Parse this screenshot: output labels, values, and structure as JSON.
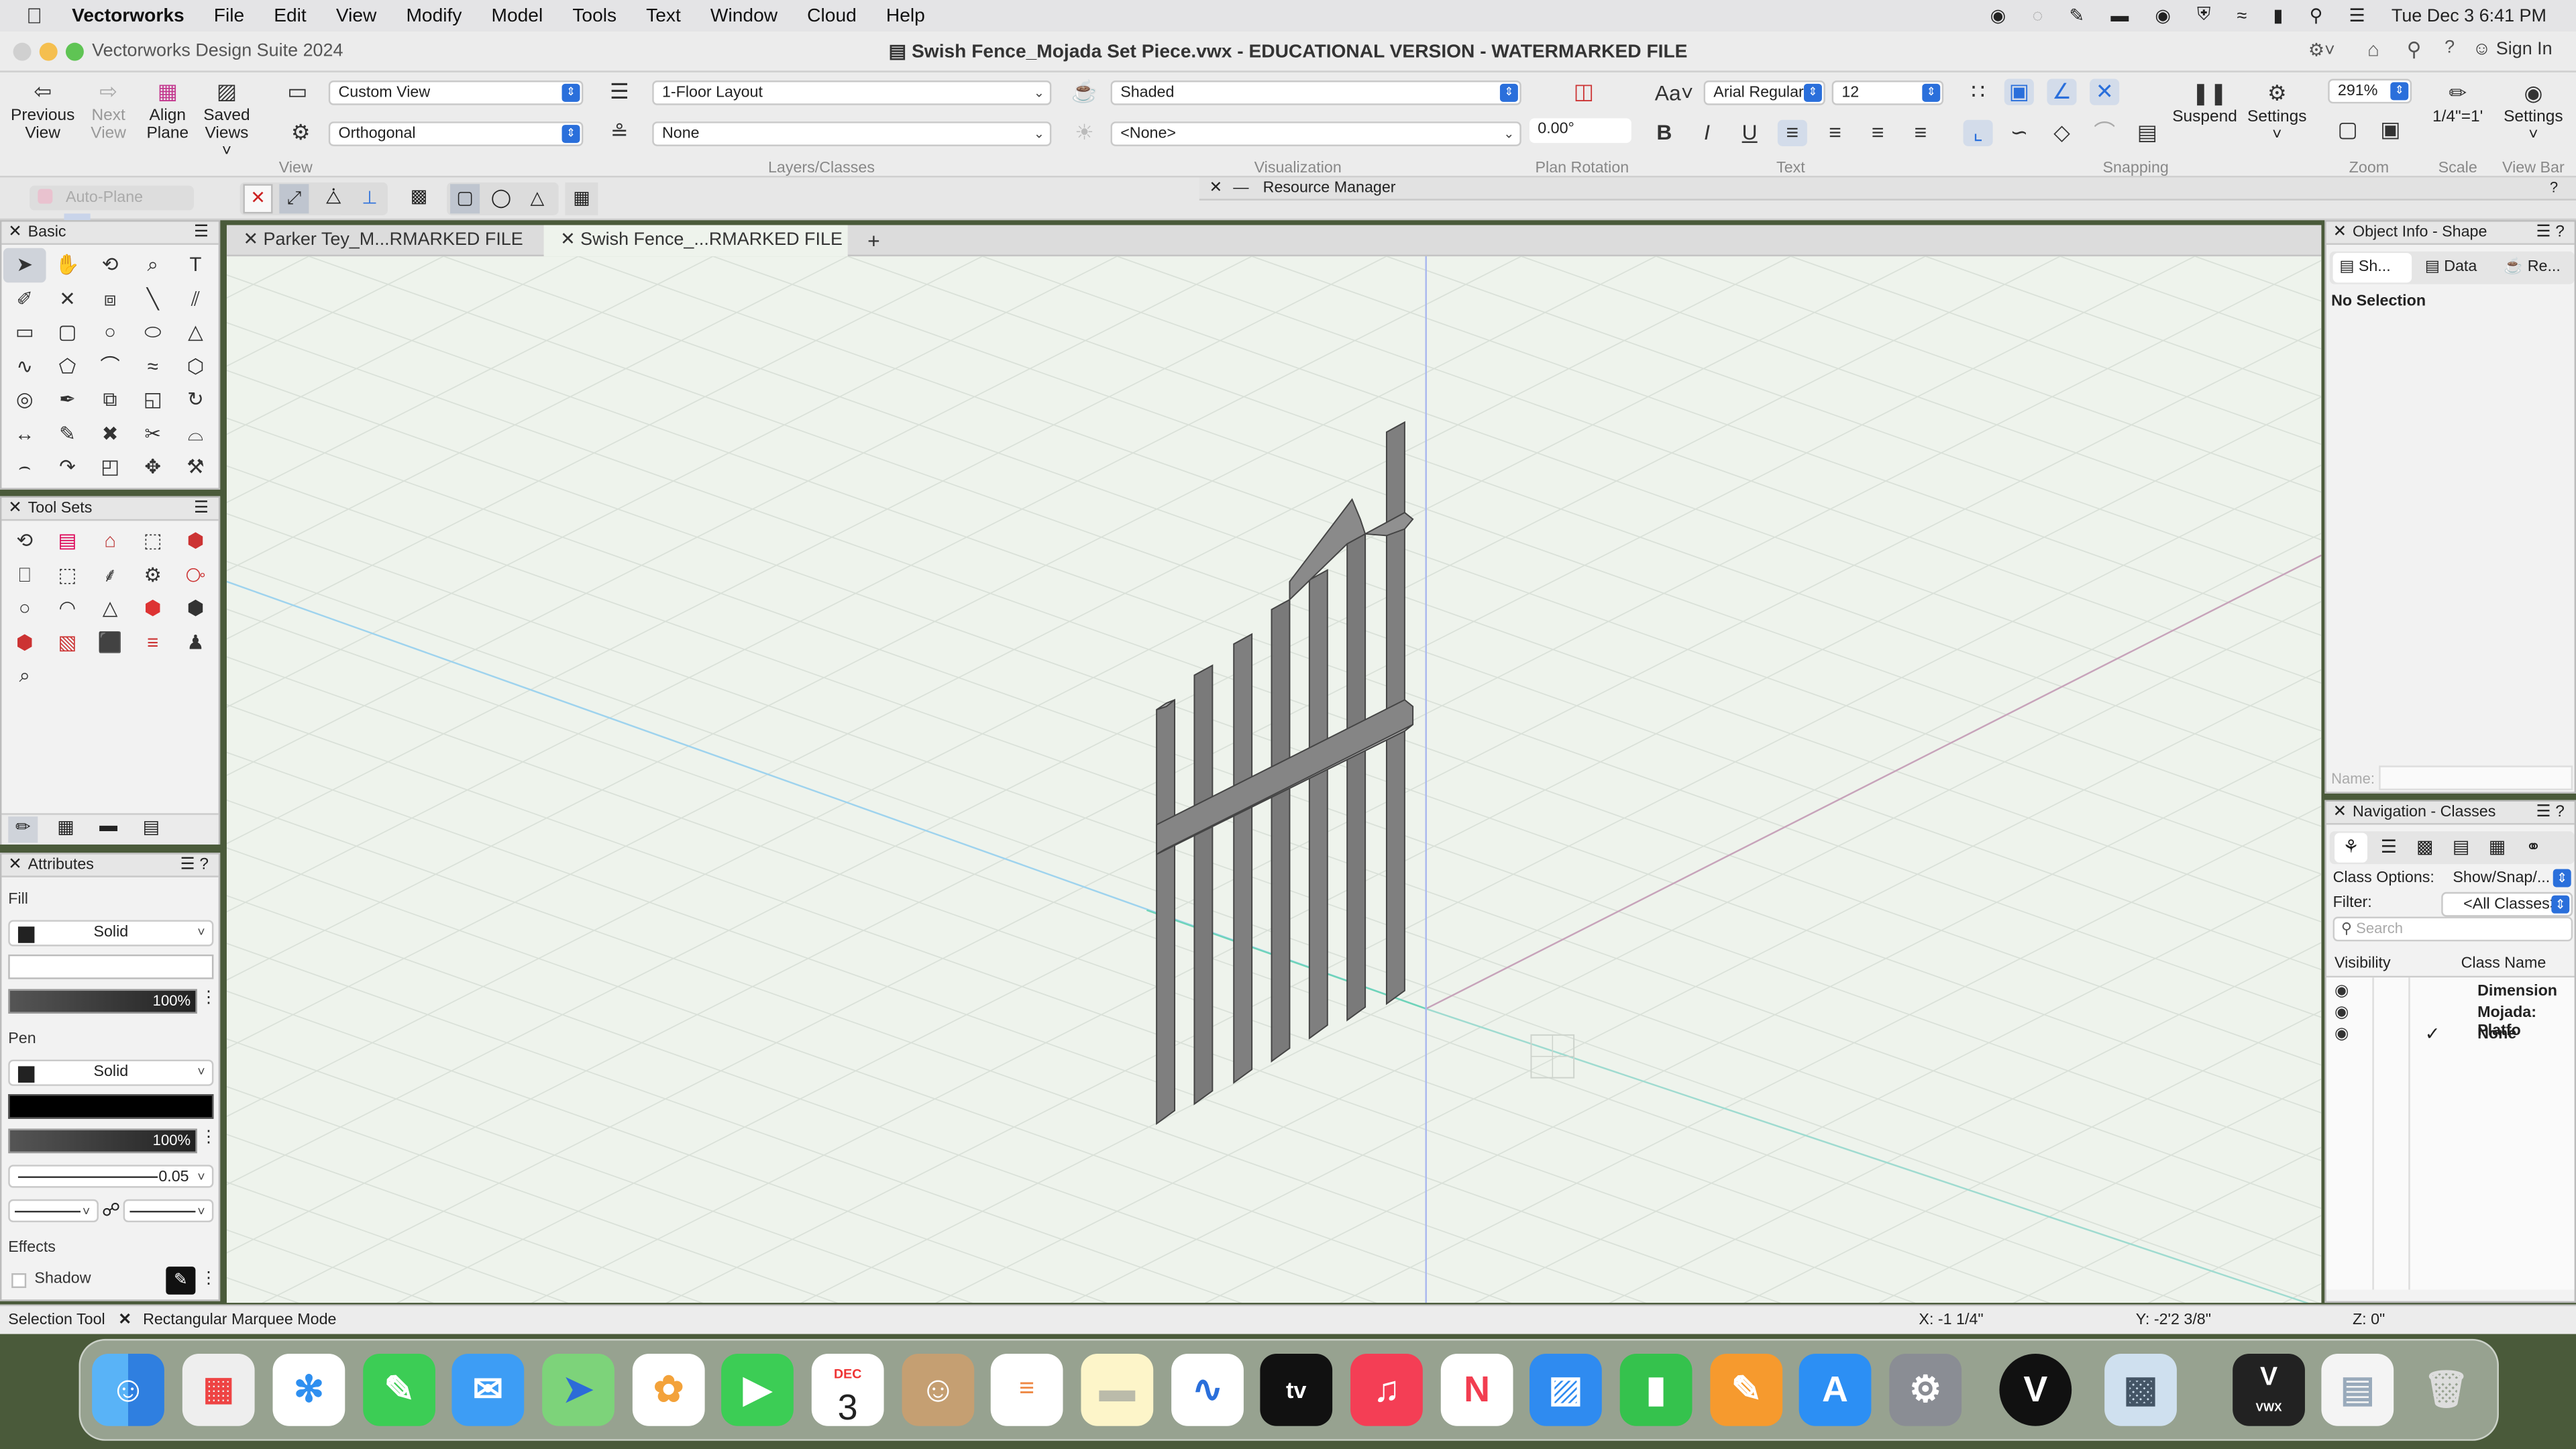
{
  "menubar": {
    "apple_icon": "apple-icon",
    "app": "Vectorworks",
    "items": [
      "File",
      "Edit",
      "View",
      "Modify",
      "Model",
      "Tools",
      "Text",
      "Window",
      "Cloud",
      "Help"
    ],
    "clock": "Tue Dec 3  6:41 PM"
  },
  "titlebar": {
    "app_title": "Vectorworks Design Suite 2024",
    "doc_title": "Swish Fence_Mojada Set Piece.vwx - EDUCATIONAL VERSION - WATERMARKED FILE",
    "sign_in": "Sign In"
  },
  "toolbar": {
    "previous_view": "Previous View",
    "next_view": "Next View",
    "align_plane": "Align Plane",
    "saved_views": "Saved Views",
    "view_dd": "Custom View",
    "projection_dd": "Orthogonal",
    "view_group": "View",
    "layer_dd": "1-Floor Layout",
    "class_dd": "None",
    "layers_group": "Layers/Classes",
    "render_dd": "Shaded",
    "light_dd": "<None>",
    "visualization_group": "Visualization",
    "plan_rotation": "0.00°",
    "plan_rotation_group": "Plan Rotation",
    "font_dd": "Arial Regular",
    "size_dd": "12",
    "text_group": "Text",
    "suspend": "Suspend",
    "settings": "Settings",
    "snapping_group": "Snapping",
    "zoom_dd": "291%",
    "zoom_group": "Zoom",
    "scale_value": "1/4\"=1'",
    "scale_group": "Scale",
    "viewbar_settings": "Settings",
    "viewbar_group": "View Bar"
  },
  "row2": {
    "auto_plane": "Auto-Plane",
    "resource_manager": "Resource Manager"
  },
  "tabs": [
    "Parker Tey_M...RMARKED FILE",
    "Swish Fence_...RMARKED FILE"
  ],
  "basic_palette": {
    "title": "Basic",
    "tools": [
      "selection-arrow-icon",
      "pan-hand-icon",
      "flyover-icon",
      "zoom-icon",
      "text-T-icon",
      "callout-icon",
      "x-icon",
      "push-pull-icon",
      "line-icon",
      "double-line-icon",
      "rectangle-icon",
      "rounded-rect-icon",
      "circle-icon",
      "oval-icon",
      "triangle-icon",
      "freehand-icon",
      "polygon-icon",
      "curve-icon",
      "nurbs-icon",
      "hexagon-icon",
      "spiral-icon",
      "eyedropper-icon",
      "crop-icon",
      "offset-icon",
      "rotate-icon",
      "mirror-icon",
      "pencil-icon",
      "trim-icon",
      "split-icon",
      "fillet-icon",
      "arc-icon",
      "clip-icon",
      "extrude-icon",
      "transform-icon",
      "hammer-icon"
    ]
  },
  "toolsets": {
    "title": "Tool Sets",
    "tools": [
      "visualization-icon",
      "building-shell-icon",
      "site-planning-icon",
      "3d-modeling-icon",
      "detailing-icon",
      "furniture-icon",
      "dims-icon",
      "landscape-icon",
      "machine-icon",
      "spotlight-icon",
      "circle-tool-icon",
      "mound-icon",
      "cone-icon",
      "cube-red-icon",
      "cube-icon",
      "rigging-icon",
      "truss-icon",
      "box-icon",
      "stack-icon",
      "person-icon",
      "search-tool-icon"
    ]
  },
  "attributes": {
    "title": "Attributes",
    "fill_label": "Fill",
    "fill_style": "Solid",
    "fill_opacity": "100%",
    "pen_label": "Pen",
    "pen_style": "Solid",
    "pen_opacity": "100%",
    "line_weight": "0.05",
    "effects_label": "Effects",
    "shadow_label": "Shadow"
  },
  "object_info": {
    "title": "Object Info - Shape",
    "tab_shape": "Sh...",
    "tab_data": "Data",
    "tab_render": "Re...",
    "no_selection": "No Selection",
    "name_label": "Name:"
  },
  "navigation": {
    "title": "Navigation - Classes",
    "class_options_label": "Class Options:",
    "class_options_value": "Show/Snap/...",
    "filter_label": "Filter:",
    "filter_value": "<All Classes>",
    "search_placeholder": "Search",
    "col_visibility": "Visibility",
    "col_class_name": "Class Name",
    "rows": [
      "Dimension",
      "Mojada: Platfo",
      "None"
    ],
    "active_mark": "✓"
  },
  "statusbar": {
    "tool": "Selection Tool",
    "mode": "Rectangular Marquee Mode",
    "x": "X: -1 1/4\"",
    "y": "Y: -2'2 3/8\"",
    "z": "Z: 0\""
  },
  "dock": {
    "calendar_month": "DEC",
    "calendar_day": "3",
    "vwx_label": "VWX",
    "apps": [
      "finder-icon",
      "launchpad-icon",
      "safari-icon",
      "messages-icon",
      "mail-icon",
      "maps-icon",
      "photos-icon",
      "facetime-icon",
      "calendar-icon",
      "contacts-icon",
      "reminders-icon",
      "notes-icon",
      "freeform-icon",
      "appletv-icon",
      "music-icon",
      "news-icon",
      "keynote-icon",
      "numbers-icon",
      "pages-icon",
      "appstore-icon",
      "settings-icon",
      "vectorworks-icon",
      "preview-icon",
      "vwx-file-icon",
      "document-icon",
      "trash-icon"
    ]
  }
}
